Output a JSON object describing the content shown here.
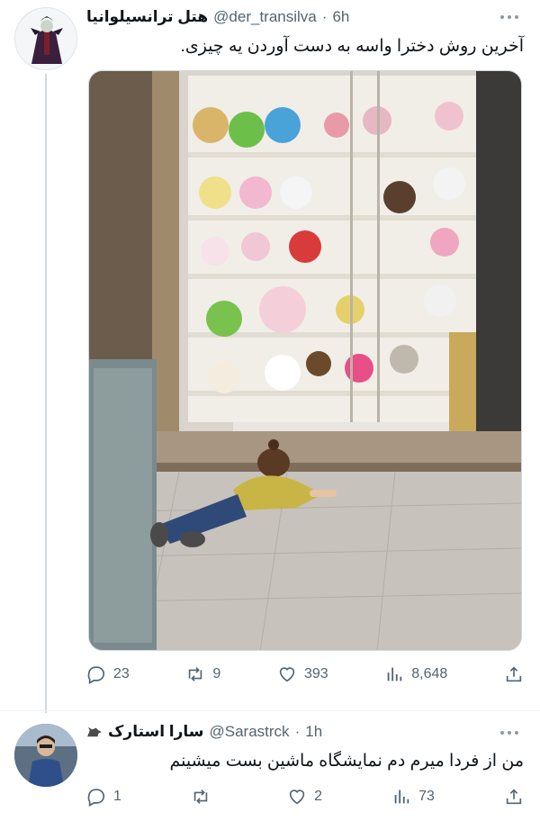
{
  "tweets": [
    {
      "display_name": "هتل ترانسیلوانیا",
      "handle": "@der_transilva",
      "separator": "·",
      "time": "6h",
      "text": "آخرین روش دخترا واسه به دست آوردن یه چیزی.",
      "avatar_icon": "villain-cartoon-avatar",
      "media_icon": "photo-child-lying-before-toy-shop",
      "counts": {
        "replies": "23",
        "retweets": "9",
        "likes": "393",
        "views": "8,648"
      }
    },
    {
      "display_name": "سارا استارک",
      "handle": "@Sarastrck",
      "separator": "·",
      "time": "1h",
      "text": "من از فردا میرم دم نمایشگاه ماشین بست میشینم",
      "avatar_icon": "person-photo-avatar",
      "badge_icon": "wolf-emoji-icon",
      "counts": {
        "replies": "1",
        "retweets": "",
        "likes": "2",
        "views": "73"
      }
    }
  ],
  "icons": [
    "reply-icon",
    "retweet-icon",
    "like-icon",
    "views-icon",
    "share-icon",
    "more-options-icon"
  ],
  "colors": {
    "text": "#0f1419",
    "secondary": "#536471",
    "border": "#cfd9de",
    "background": "#ffffff"
  }
}
